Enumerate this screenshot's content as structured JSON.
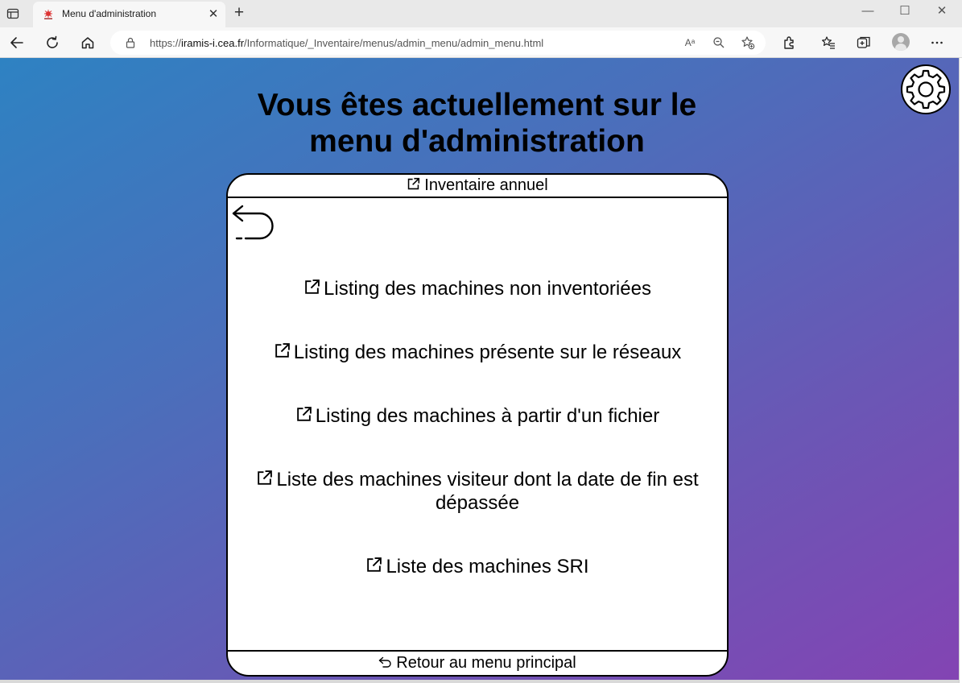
{
  "browser": {
    "tab_title": "Menu d'administration",
    "url_prefix": "https://",
    "url_host": "iramis-i.cea.fr",
    "url_path": "/Informatique/_Inventaire/menus/admin_menu/admin_menu.html",
    "read_aloud_label": "Aᵃ"
  },
  "page": {
    "title": "Vous êtes actuellement sur le menu d'administration",
    "header_link": "Inventaire annuel",
    "menu_items": [
      "Listing des machines non inventoriées",
      "Listing des machines présente sur le réseaux",
      "Listing des machines à partir d'un fichier",
      "Liste des machines visiteur dont la date de fin est dépassée",
      "Liste des machines SRI"
    ],
    "footer_link": "Retour au menu principal"
  },
  "colors": {
    "gradient_start": "#2e82c2",
    "gradient_end": "#8344b3",
    "panel_bg": "#ffffff",
    "text": "#000000"
  },
  "icons": [
    "settings-gear-icon",
    "back-arrow-icon",
    "external-link-icon",
    "undo-icon"
  ]
}
